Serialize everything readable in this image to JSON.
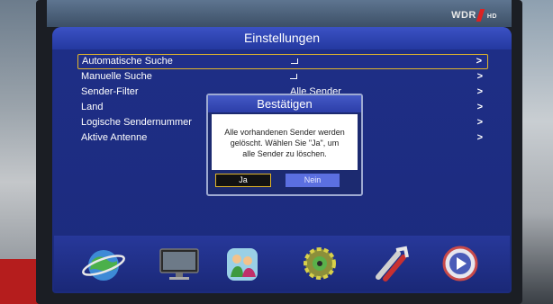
{
  "watermark": {
    "channel": "WDR",
    "quality": "HD"
  },
  "menu": {
    "title": "Einstellungen",
    "items": [
      {
        "label": "Automatische Suche",
        "value": "",
        "enter": true,
        "selected": true
      },
      {
        "label": "Manuelle Suche",
        "value": "",
        "enter": true,
        "selected": false
      },
      {
        "label": "Sender-Filter",
        "value": "Alle Sender",
        "enter": false,
        "selected": false
      },
      {
        "label": "Land",
        "value": "",
        "enter": false,
        "selected": false
      },
      {
        "label": "Logische Sendernummer",
        "value": "",
        "enter": false,
        "selected": false
      },
      {
        "label": "Aktive Antenne",
        "value": "",
        "enter": false,
        "selected": false
      }
    ]
  },
  "dialog": {
    "title": "Bestätigen",
    "line1": "Alle vorhandenen Sender werden",
    "line2": "gelöscht. Wählen Sie \"Ja\", um",
    "line3": "alle Sender zu löschen.",
    "yes_label": "Ja",
    "no_label": "Nein"
  },
  "icons": [
    "satellite-globe-icon",
    "tv-monitor-icon",
    "parental-family-icon",
    "settings-gear-icon",
    "tools-icon",
    "media-play-icon"
  ],
  "colors": {
    "selection": "#e3b62a",
    "panel": "#1c2b7d",
    "no_button": "#5b6fe0"
  }
}
